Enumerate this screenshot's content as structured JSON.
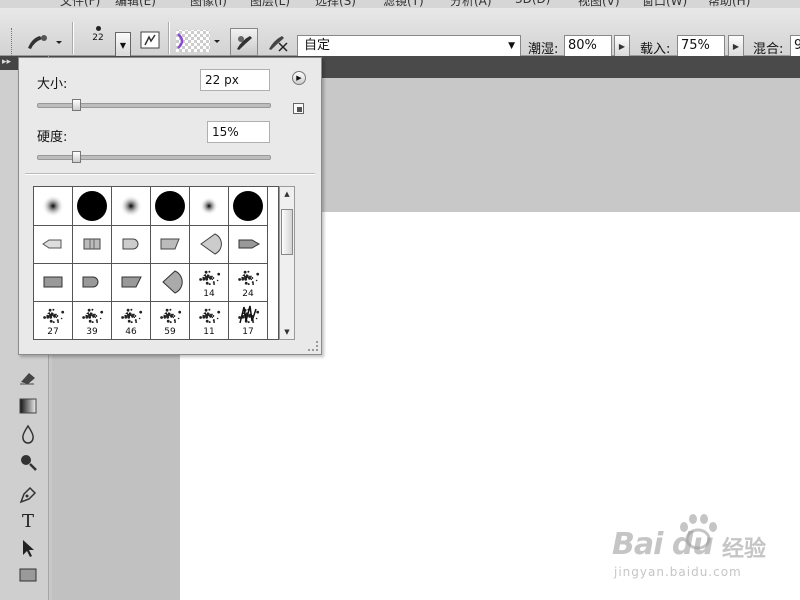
{
  "menu": {
    "items": [
      "文件(F)",
      "编辑(E)",
      "图像(I)",
      "图层(L)",
      "选择(S)",
      "滤镜(T)",
      "分析(A)",
      "3D(D)",
      "视图(V)",
      "窗口(W)",
      "帮助(H)"
    ]
  },
  "options": {
    "brush_size_preview": "22",
    "mode_value": "自定",
    "wetness_label": "潮湿:",
    "wetness_value": "80%",
    "load_label": "载入:",
    "load_value": "75%",
    "mix_label": "混合:",
    "mix_value": "9"
  },
  "brush_popup": {
    "size_label": "大小:",
    "size_value": "22 px",
    "size_level": 0.15,
    "hardness_label": "硬度:",
    "hardness_value": "15%",
    "hardness_level": 0.15,
    "presets": [
      {
        "kind": "soft",
        "num": ""
      },
      {
        "kind": "hard",
        "num": ""
      },
      {
        "kind": "soft",
        "num": ""
      },
      {
        "kind": "hard",
        "num": ""
      },
      {
        "kind": "soft-sm",
        "num": ""
      },
      {
        "kind": "hard",
        "num": ""
      },
      {
        "kind": "tip-pencil",
        "num": ""
      },
      {
        "kind": "tip-flat",
        "num": ""
      },
      {
        "kind": "tip-round",
        "num": ""
      },
      {
        "kind": "tip-angle",
        "num": ""
      },
      {
        "kind": "tip-fan",
        "num": ""
      },
      {
        "kind": "tip-point",
        "num": ""
      },
      {
        "kind": "tip-flat2",
        "num": ""
      },
      {
        "kind": "tip-round2",
        "num": ""
      },
      {
        "kind": "tip-angle2",
        "num": ""
      },
      {
        "kind": "tip-fan2",
        "num": ""
      },
      {
        "kind": "splatter",
        "num": "14"
      },
      {
        "kind": "splatter",
        "num": "24"
      },
      {
        "kind": "splatter",
        "num": "27"
      },
      {
        "kind": "splatter",
        "num": "39"
      },
      {
        "kind": "splatter",
        "num": "46"
      },
      {
        "kind": "splatter",
        "num": "59"
      },
      {
        "kind": "splatter",
        "num": "11"
      },
      {
        "kind": "grass",
        "num": "17"
      }
    ]
  },
  "watermark": {
    "brand": "Bai du",
    "brand_cn": "经验",
    "url": "jingyan.baidu.com"
  },
  "colors": {
    "accent_purple": "#8a4bd0",
    "panel_bg": "#e9e9e9",
    "canvas_bg": "#ffffff"
  }
}
